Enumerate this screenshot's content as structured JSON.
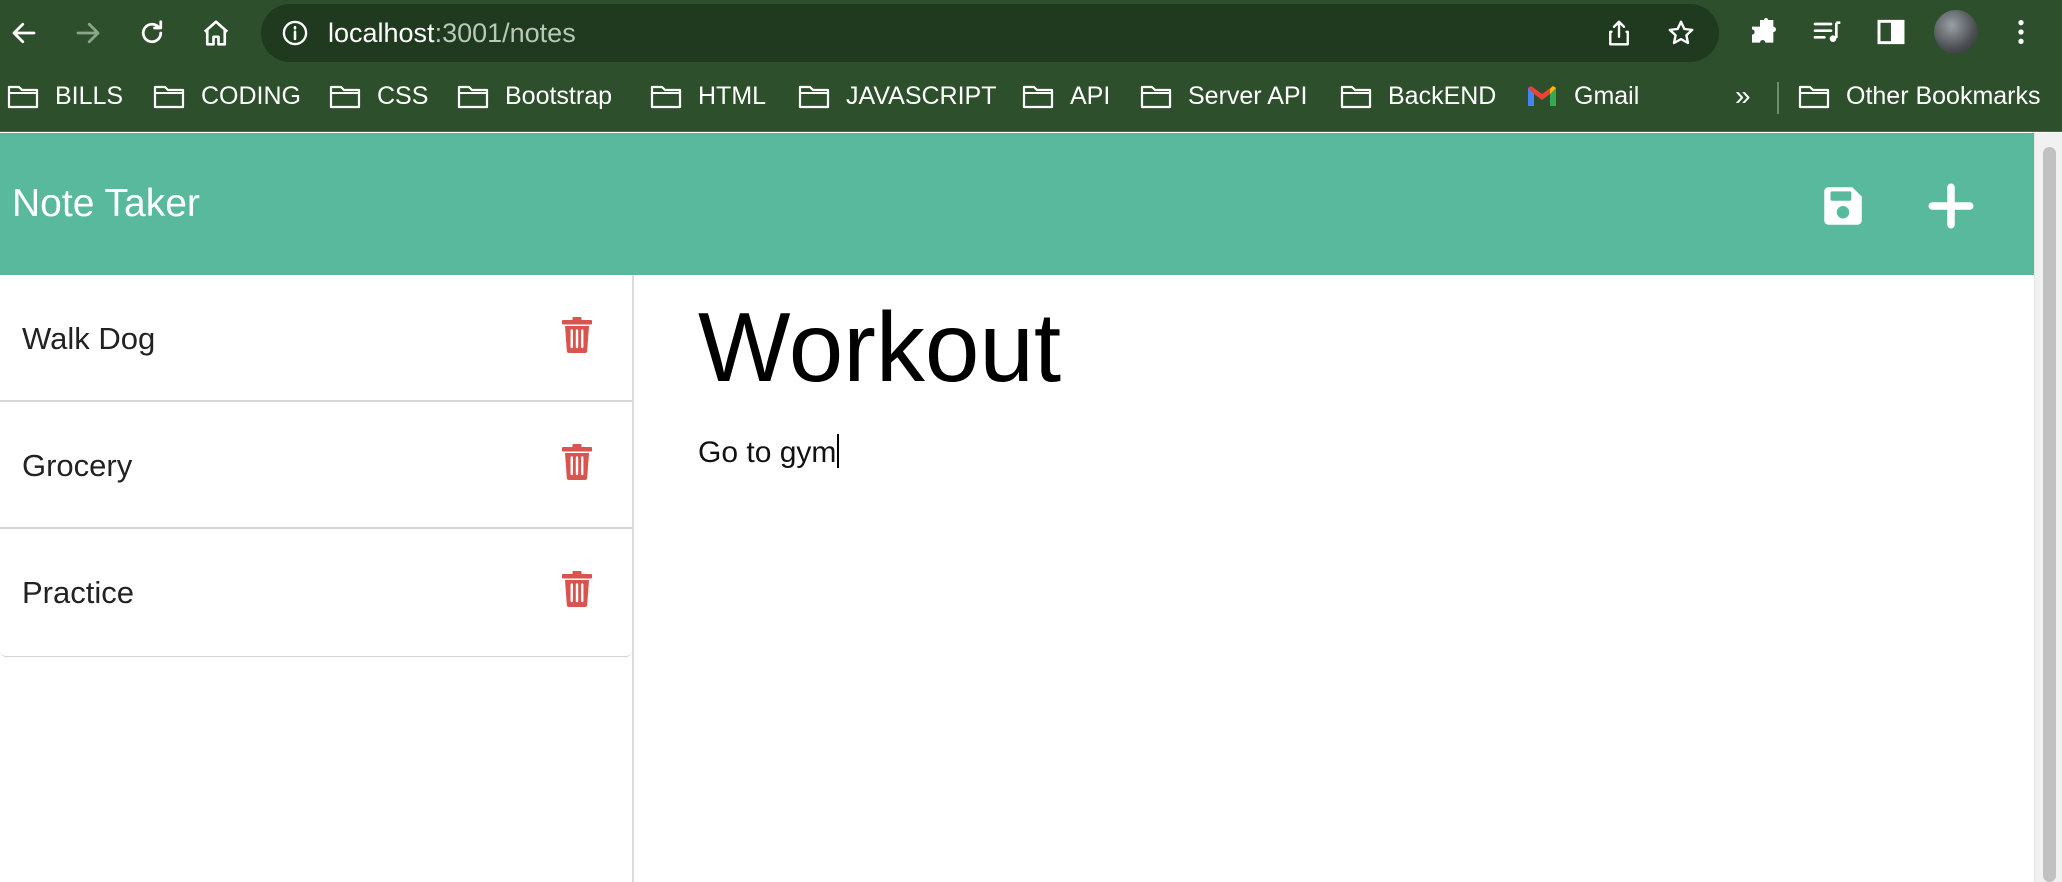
{
  "browser": {
    "url_host": "localhost",
    "url_path": ":3001/notes",
    "bookmarks": [
      {
        "label": "BILLS",
        "icon": "folder-icon"
      },
      {
        "label": "CODING",
        "icon": "folder-icon"
      },
      {
        "label": "CSS",
        "icon": "folder-icon"
      },
      {
        "label": "Bootstrap",
        "icon": "folder-icon"
      },
      {
        "label": "HTML",
        "icon": "folder-icon"
      },
      {
        "label": "JAVASCRIPT",
        "icon": "folder-icon"
      },
      {
        "label": "API",
        "icon": "folder-icon"
      },
      {
        "label": "Server API",
        "icon": "folder-icon"
      },
      {
        "label": "BackEND",
        "icon": "folder-icon"
      },
      {
        "label": "Gmail",
        "icon": "gmail-icon"
      }
    ],
    "more_bookmarks": "»",
    "other_bookmarks": "Other Bookmarks"
  },
  "app": {
    "title": "Note Taker",
    "notes": [
      {
        "title": "Walk Dog"
      },
      {
        "title": "Grocery"
      },
      {
        "title": "Practice"
      }
    ],
    "active_note": {
      "title": "Workout",
      "text": "Go to gym"
    }
  },
  "colors": {
    "header": "#59b99d",
    "delete": "#d9534f",
    "chrome": "#2e4f2c"
  }
}
